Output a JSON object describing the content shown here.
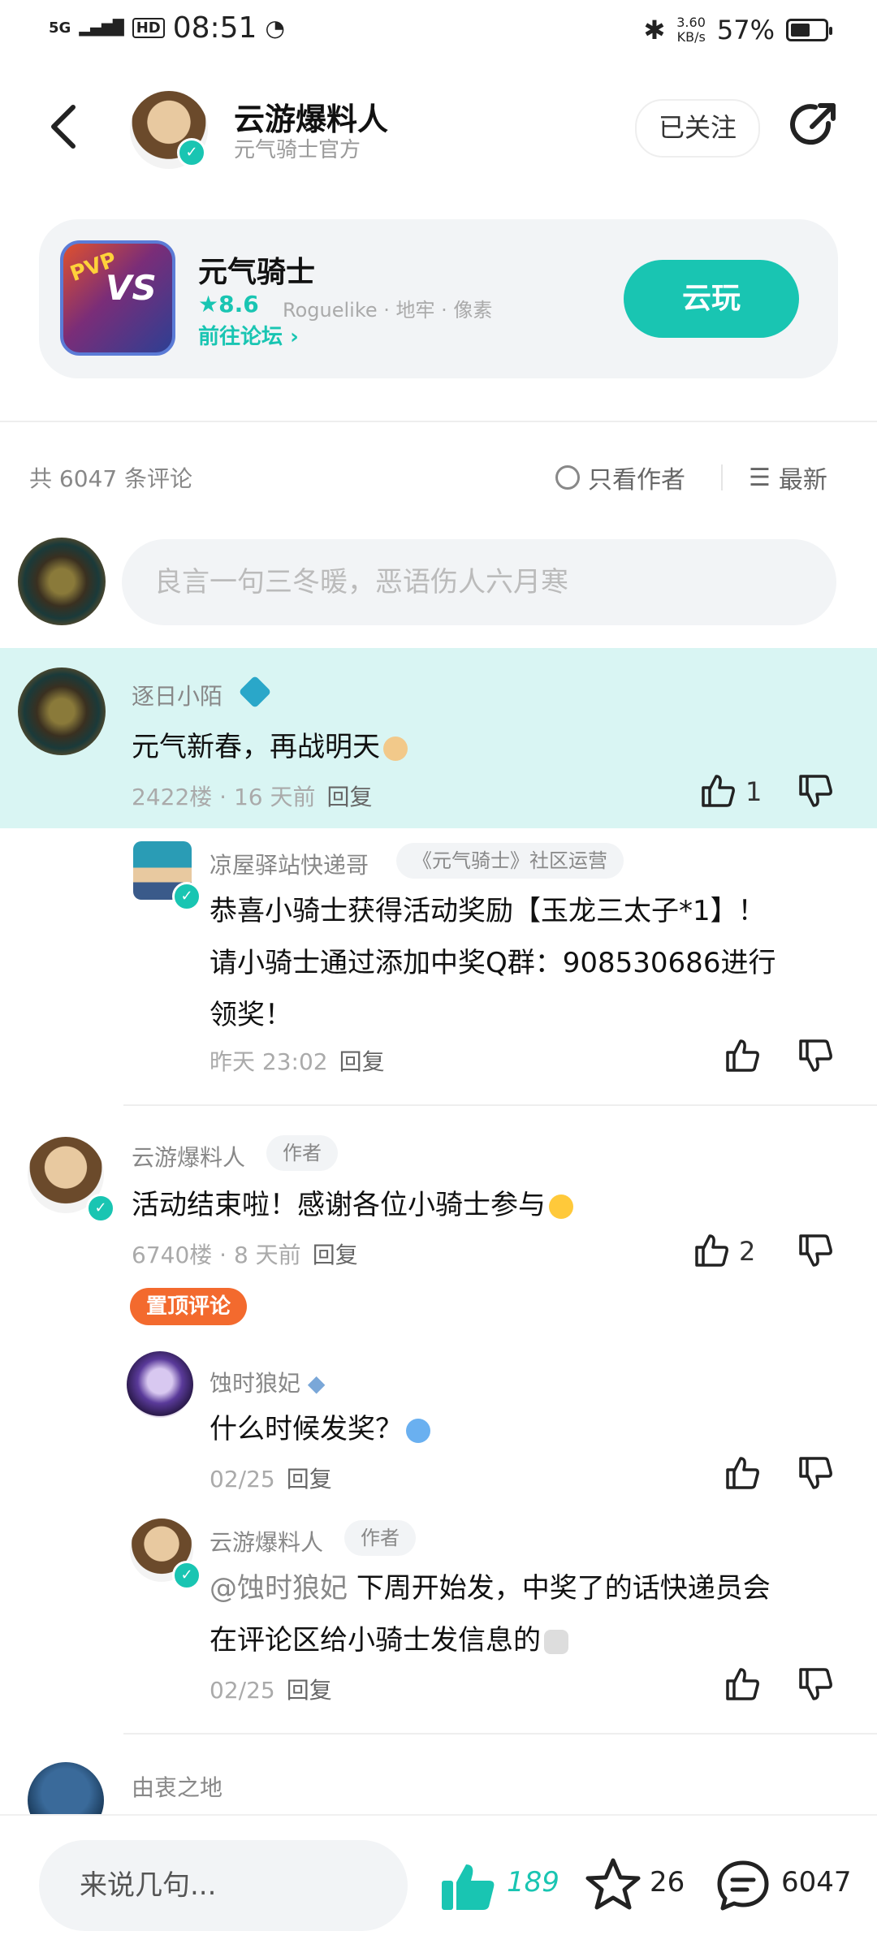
{
  "status_bar": {
    "network": "5G",
    "hd": "HD",
    "time": "08:51",
    "speed": "3.60",
    "speed_unit": "KB/s",
    "battery": "57%",
    "battery_level": 0.57
  },
  "header": {
    "name": "云游爆料人",
    "subtitle": "元气骑士官方",
    "follow_label": "已关注"
  },
  "game": {
    "pvp": "PVP",
    "vs": "VS",
    "name": "元气骑士",
    "rating": "8.6",
    "tags": "Roguelike · 地牢 · 像素",
    "forum_link": "前往论坛",
    "play_label": "云玩"
  },
  "filter": {
    "count_label": "共 6047 条评论",
    "only_author": "只看作者",
    "sort": "最新"
  },
  "comment_input": {
    "placeholder": "良言一句三冬暖，恶语伤人六月寒"
  },
  "comments": [
    {
      "name": "逐日小陌",
      "text": "元气新春，再战明天",
      "meta": "2422楼 · 16 天前",
      "reply": "回复",
      "likes": "1"
    },
    {
      "name": "凉屋驿站快递哥",
      "badge": "《元气骑士》社区运营",
      "line1": "恭喜小骑士获得活动奖励【玉龙三太子*1】！",
      "line2": "请小骑士通过添加中奖Q群：908530686进行",
      "line3": "领奖！",
      "meta": "昨天 23:02",
      "reply": "回复"
    },
    {
      "name": "云游爆料人",
      "badge": "作者",
      "text": "活动结束啦！感谢各位小骑士参与",
      "meta": "6740楼 · 8 天前",
      "reply": "回复",
      "likes": "2",
      "pinned": "置顶评论"
    },
    {
      "name": "蚀时狼妃",
      "text": "什么时候发奖？",
      "meta": "02/25",
      "reply": "回复"
    },
    {
      "name": "云游爆料人",
      "badge": "作者",
      "mention": "@蚀时狼妃",
      "line1": "下周开始发，中奖了的话快递员会",
      "line2": "在评论区给小骑士发信息的",
      "meta": "02/25",
      "reply": "回复"
    },
    {
      "name": "由衷之地"
    }
  ],
  "bottom": {
    "input_placeholder": "来说几句...",
    "likes": "189",
    "favorites": "26",
    "comments": "6047"
  },
  "colors": {
    "accent": "#19c5b2",
    "highlight_bg": "#d9f5f3",
    "pinned": "#f36a2e"
  }
}
